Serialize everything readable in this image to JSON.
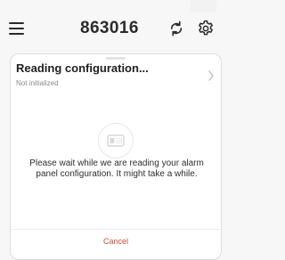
{
  "header": {
    "title": "863016",
    "menu_icon": "hamburger-menu-icon",
    "refresh_icon": "refresh-icon",
    "settings_icon": "gear-icon"
  },
  "card": {
    "title": "Reading configuration...",
    "status": "Not initialized",
    "chevron_icon": "chevron-right-icon",
    "panel_icon": "alarm-panel-icon",
    "message": "Please wait while we are reading your alarm panel configuration. It might take a while.",
    "cancel_label": "Cancel"
  },
  "colors": {
    "cancel": "#d8453a",
    "text": "#1f1f1f",
    "muted": "#8a8a8a"
  }
}
